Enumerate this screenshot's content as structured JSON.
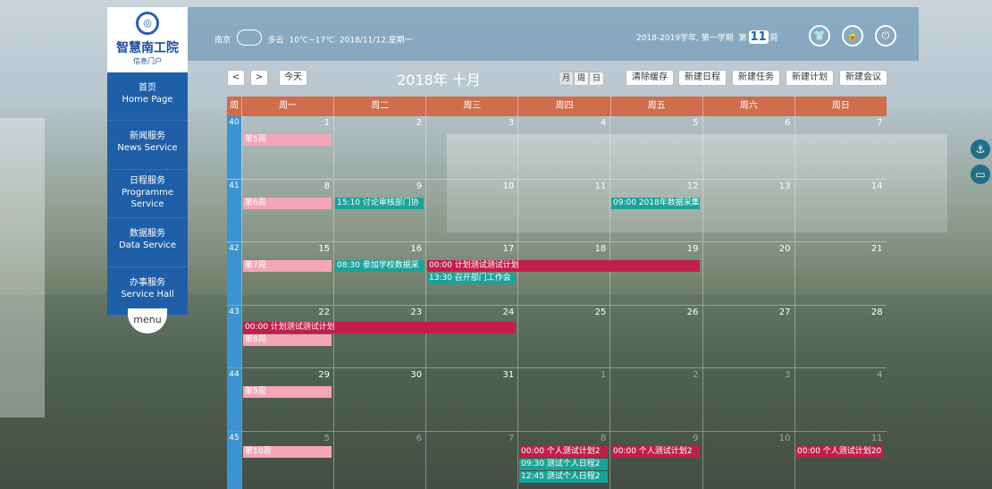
{
  "logo": {
    "title": "智慧南工院",
    "subtitle": "信息门户"
  },
  "menu": [
    {
      "zh": "首页",
      "en": "Home Page"
    },
    {
      "zh": "新闻服务",
      "en": "News Service"
    },
    {
      "zh": "日程服务",
      "en": "Programme Service"
    },
    {
      "zh": "数据服务",
      "en": "Data Service"
    },
    {
      "zh": "办事服务",
      "en": "Service Hall"
    }
  ],
  "menu_button": "menu",
  "weather": {
    "city": "南京",
    "condition": "多云",
    "temp": "10℃~17℃",
    "date": "2018/11/12,星期一"
  },
  "term": {
    "text": "2018-2019学年, 第一学期",
    "week_prefix": "第",
    "week": "11",
    "week_suffix": "周"
  },
  "toolbar": {
    "prev": "<",
    "next": ">",
    "today": "今天",
    "title": "2018年 十月",
    "views": [
      "月",
      "周",
      "日"
    ],
    "actions": [
      "清除缓存",
      "新建日程",
      "新建任务",
      "新建计划",
      "新建会议"
    ]
  },
  "calendar": {
    "header_week": "周",
    "days": [
      "周一",
      "周二",
      "周三",
      "周四",
      "周五",
      "周六",
      "周日"
    ],
    "weeks": [
      {
        "num": "40",
        "dates": [
          "1",
          "2",
          "3",
          "4",
          "5",
          "6",
          "7"
        ]
      },
      {
        "num": "41",
        "dates": [
          "8",
          "9",
          "10",
          "11",
          "12",
          "13",
          "14"
        ]
      },
      {
        "num": "42",
        "dates": [
          "15",
          "16",
          "17",
          "18",
          "19",
          "20",
          "21"
        ]
      },
      {
        "num": "43",
        "dates": [
          "22",
          "23",
          "24",
          "25",
          "26",
          "27",
          "28"
        ]
      },
      {
        "num": "44",
        "dates": [
          "29",
          "30",
          "31",
          "1",
          "2",
          "3",
          "4"
        ]
      },
      {
        "num": "45",
        "dates": [
          "5",
          "6",
          "7",
          "8",
          "9",
          "10",
          "11"
        ]
      }
    ],
    "events": {
      "w40_label": "第5周",
      "w41_label": "第6周",
      "w41_e1": "15:10 讨论审核部门协",
      "w41_e2": "09:00 2018年数据采集",
      "w42_label": "第7周",
      "w42_e1": "08:30 参加学校数据采",
      "w42_e2": "00:00 计划测试测试计划",
      "w42_e3": "13:30 召开部门工作会",
      "w43_e1": "00:00 计划测试测试计划",
      "w43_label": "第8周",
      "w44_label": "第9周",
      "w45_label": "第10周",
      "w45_e1": "00:00 个人测试计划2",
      "w45_e2": "00:00 个人测试计划2",
      "w45_e3": "00:00 个人测试计划20",
      "w45_e4": "09:30 测试个人日程2",
      "w45_e5": "12:45 测试个人日程2"
    }
  }
}
